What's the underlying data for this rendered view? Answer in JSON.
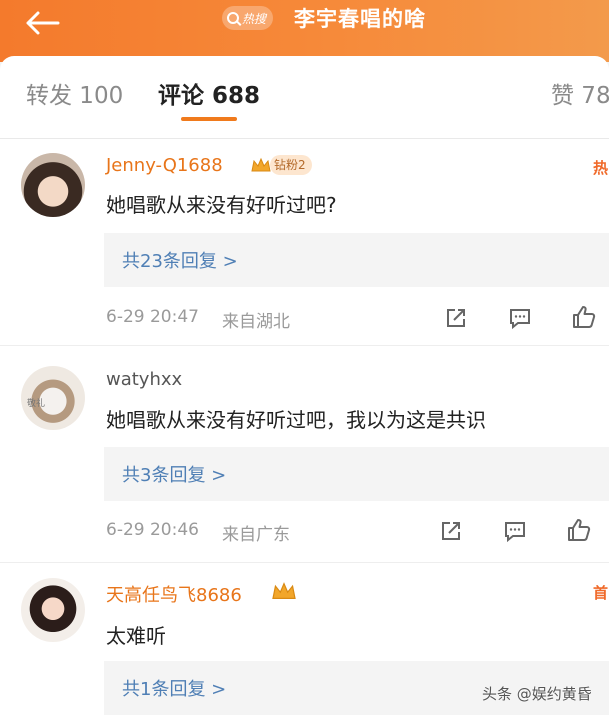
{
  "header": {
    "hot_tag": "热搜",
    "topic_title": "李宇春唱的啥"
  },
  "tabs": {
    "repost": "转发 100",
    "comment": "评论 688",
    "like": "赞 78"
  },
  "comments": [
    {
      "username": "Jenny-Q1688",
      "badge": "钻粉2",
      "right_tag": "热",
      "text": "她唱歌从来没有好听过吧?",
      "replies": "共23条回复 >",
      "time": "6-29 20:47",
      "location": "来自湖北"
    },
    {
      "username": "watyhxx",
      "avatar_text": "敬礼",
      "text": "她唱歌从来没有好听过吧，我以为这是共识",
      "replies": "共3条回复 >",
      "time": "6-29 20:46",
      "location": "来自广东"
    },
    {
      "username": "天高任鸟飞8686",
      "right_tag": "首",
      "text": "太难听",
      "replies": "共1条回复 >"
    }
  ],
  "watermark": "头条 @娱约黄昏",
  "colors": {
    "header_orange": "#f47a2c",
    "username_orange": "#e8751a",
    "reply_link_blue": "#4f7fb5",
    "tab_underline": "#f07a1c"
  }
}
